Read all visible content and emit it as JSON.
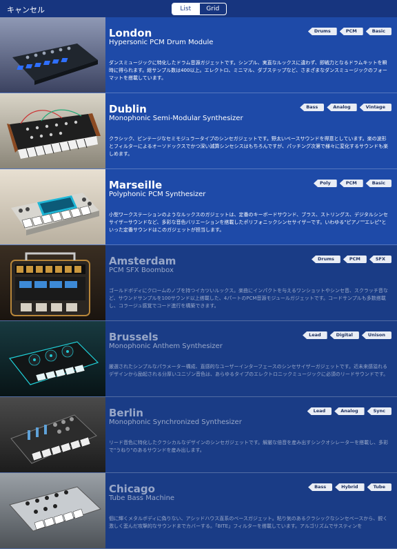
{
  "header": {
    "cancel_label": "キャンセル",
    "tabs": [
      "List",
      "Grid"
    ]
  },
  "items": [
    {
      "name": "London",
      "subtitle": "Hypersonic PCM Drum Module",
      "tags": [
        "Drums",
        "PCM",
        "Basic"
      ],
      "description": "ダンスミュージックに特化したドラム音源ガジェットです。シンプル、実直なルックスに違わず、即戦力となるドラムキットを瞬時に得られます。総サンプル数は400以上。エレクトロ、ミニマル、ダブステップなど、さまざまなダンスミュージックのフォーマットを搭載しています。"
    },
    {
      "name": "Dublin",
      "subtitle": "Monophonic Semi-Modular Synthesizer",
      "tags": [
        "Bass",
        "Analog",
        "Vintage"
      ],
      "description": "クラシック、ビンテージなセミモジュラータイプのシンセガジェットです。野太いベースサウンドを得意としています。楽の波形とフィルターによるオーソドックスでかつ深い減算シンセシスはもちろんですが、パッチング次第で様々に変化するサウンドも楽しめます。"
    },
    {
      "name": "Marseille",
      "subtitle": "Polyphonic PCM Synthesizer",
      "tags": [
        "Poly",
        "PCM",
        "Basic"
      ],
      "description": "小型ワークステーションのようなルックスのガジェットは、定番のキーボードサウンド、ブラス、ストリングス、デジタルシンセサイザーサウンドなど、多彩な音色バリエーションを搭載したポリフォニックシンセサイザーです。いわゆる\"ピアノ\"\"エレピ\"といった定番サウンドはこのガジェットが担当します。"
    },
    {
      "name": "Amsterdam",
      "subtitle": "PCM SFX Boombox",
      "tags": [
        "Drums",
        "PCM",
        "SFX"
      ],
      "description": "ゴールドボディにクロームのノブを持つイカツいルックス。楽曲にインパクトを与えるワンショットやシンセ音、スクラッチ音など、サウンドサンプルを100サウンド以上搭載した、4パートのPCM音源モジュールガジェットです。コードサンプルも多数搭載し、コラージュ感覚でコード進行を構築できます。"
    },
    {
      "name": "Brussels",
      "subtitle": "Monophonic Anthem Synthesizer",
      "tags": [
        "Lead",
        "Digital",
        "Unison"
      ],
      "description": "厳選されたシンプルなパラメーター構成、直感的なユーザーインターフェースのシンセサイザーガジェットです。近未来感溢れるデザインから励起される分厚いユニゾン音色は、あらゆるタイプのエレクトロニックミュージックに必須のリードサウンドです。"
    },
    {
      "name": "Berlin",
      "subtitle": "Monophonic Synchronized Synthesizer",
      "tags": [
        "Lead",
        "Analog",
        "Sync"
      ],
      "description": "リード音色に特化したクラシカルなデザインのシンセガジェットです。解厳な倍音を産み出すシンクオシレーターを搭載し、多彩で\"うねり\"のあるサウンドを産み出します。"
    },
    {
      "name": "Chicago",
      "subtitle": "Tube Bass Machine",
      "tags": [
        "Bass",
        "Hybrid",
        "Tube"
      ],
      "description": "個に輝くメタルボディに偽りない、アシッドハウス直系のベースガジェット。粘り気のあるクラシックなシンセベースから、鋭く激しく歪んだ攻撃的なサウンドまでカバーする。「BITE」フィルターを搭載しています。アルゴリズムでサスティンを"
    }
  ],
  "colors": {
    "row_bright": "#1e4aa8",
    "row_dim": "#1a3c86",
    "tag_bg": "#e9edf5"
  }
}
